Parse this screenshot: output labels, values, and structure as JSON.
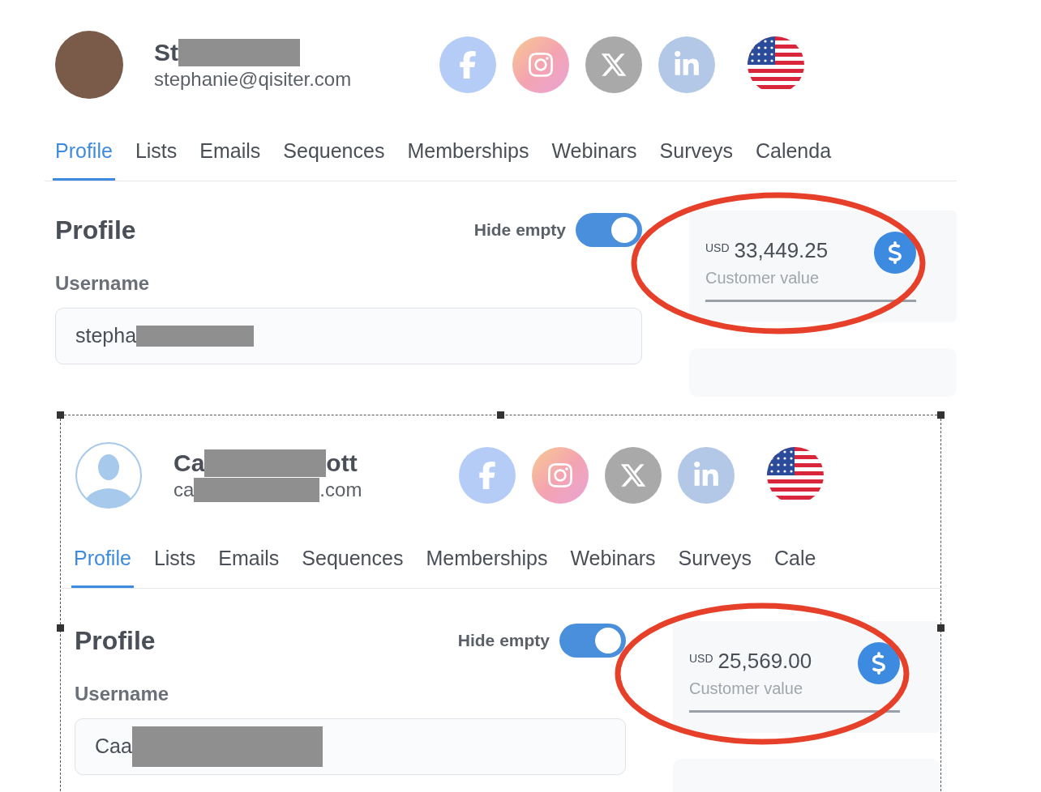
{
  "panels": [
    {
      "selected": false,
      "profile": {
        "avatar": {
          "kind": "photo"
        },
        "name_parts": [
          "St"
        ],
        "name_redacted_end": true,
        "email_parts": [
          "stephanie@qisiter.com"
        ]
      },
      "socials": [
        {
          "kind": "facebook"
        },
        {
          "kind": "instagram"
        },
        {
          "kind": "x"
        },
        {
          "kind": "linkedin"
        },
        {
          "kind": "flag"
        }
      ],
      "tabs": [
        {
          "label": "Profile",
          "selected": true
        },
        {
          "label": "Lists",
          "selected": false
        },
        {
          "label": "Emails",
          "selected": false
        },
        {
          "label": "Sequences",
          "selected": false
        },
        {
          "label": "Memberships",
          "selected": false
        },
        {
          "label": "Webinars",
          "selected": false
        },
        {
          "label": "Surveys",
          "selected": false
        },
        {
          "label": "Calenda",
          "selected": false
        }
      ],
      "section": {
        "title": "Profile",
        "hide_empty": {
          "label": "Hide empty",
          "on": true
        },
        "field": {
          "label": "Username",
          "value_parts": [
            "stepha"
          ],
          "value_redacted_end": true
        }
      },
      "value_card": {
        "currency": "USD",
        "amount": "33,449.25",
        "label": "Customer value",
        "circled": true
      }
    },
    {
      "selected": true,
      "profile": {
        "avatar": {
          "kind": "silhouette"
        },
        "name_parts": [
          "Ca",
          "ott"
        ],
        "name_redacted_end": false,
        "email_parts": [
          "ca",
          ".com"
        ]
      },
      "socials": [
        {
          "kind": "facebook"
        },
        {
          "kind": "instagram"
        },
        {
          "kind": "x"
        },
        {
          "kind": "linkedin"
        },
        {
          "kind": "flag"
        }
      ],
      "tabs": [
        {
          "label": "Profile",
          "selected": true
        },
        {
          "label": "Lists",
          "selected": false
        },
        {
          "label": "Emails",
          "selected": false
        },
        {
          "label": "Sequences",
          "selected": false
        },
        {
          "label": "Memberships",
          "selected": false
        },
        {
          "label": "Webinars",
          "selected": false
        },
        {
          "label": "Surveys",
          "selected": false
        },
        {
          "label": "Cale",
          "selected": false
        }
      ],
      "section": {
        "title": "Profile",
        "hide_empty": {
          "label": "Hide empty",
          "on": true
        },
        "field": {
          "label": "Username",
          "value_parts": [
            "Caa"
          ],
          "value_redacted_end": true
        }
      },
      "value_card": {
        "currency": "USD",
        "amount": "25,569.00",
        "label": "Customer value",
        "circled": true
      }
    }
  ]
}
